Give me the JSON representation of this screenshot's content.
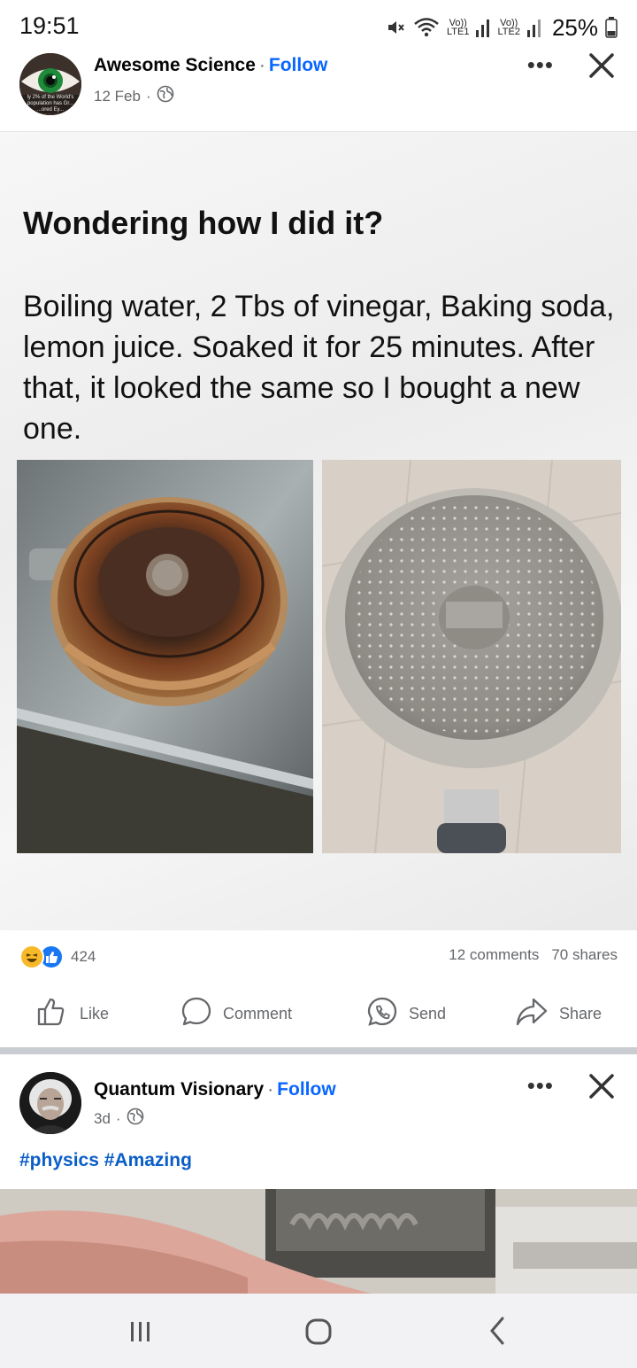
{
  "status_bar": {
    "time": "19:51",
    "sim1_top": "Vo))",
    "sim1_bottom": "LTE1",
    "sim2_top": "Vo))",
    "sim2_bottom": "LTE2",
    "battery": "25%"
  },
  "post": {
    "author": "Awesome Science",
    "separator": "·",
    "follow": "Follow",
    "date": "12 Feb",
    "date_separator": "·",
    "avatar_caption": "ly 2% of the World's population has Gr... ...ored Ey...",
    "more_label": "•••",
    "image_headline": "Wondering how I did it?",
    "image_body": "Boiling water, 2 Tbs of vinegar, Baking soda, lemon juice. Soaked it for 25 minutes. After that, it looked the same so I bought a new one.",
    "reaction_count": "424",
    "comments": "12 comments",
    "shares": "70 shares",
    "actions": {
      "like": "Like",
      "comment": "Comment",
      "send": "Send",
      "share": "Share"
    }
  },
  "post2": {
    "author": "Quantum Visionary",
    "separator": "·",
    "follow": "Follow",
    "date": "3d",
    "date_separator": "·",
    "more_label": "•••",
    "hashtags": "#physics #Amazing"
  },
  "colors": {
    "accent": "#0866ff",
    "hashtag": "#0a5ec8",
    "muted_text": "#65676b",
    "divider": "#c9ccd1",
    "like_blue": "#1877f2",
    "haha_yellow": "#f7b928"
  },
  "icons": {
    "status": [
      "mute-icon",
      "wifi-icon",
      "signal-icon",
      "battery-icon"
    ],
    "header": [
      "globe-icon",
      "more-icon",
      "close-icon"
    ],
    "reactions": [
      "haha-reaction-icon",
      "like-reaction-icon"
    ],
    "actions": [
      "like-icon",
      "comment-icon",
      "send-icon",
      "share-icon"
    ],
    "nav": [
      "recents-icon",
      "home-icon",
      "back-icon"
    ]
  }
}
